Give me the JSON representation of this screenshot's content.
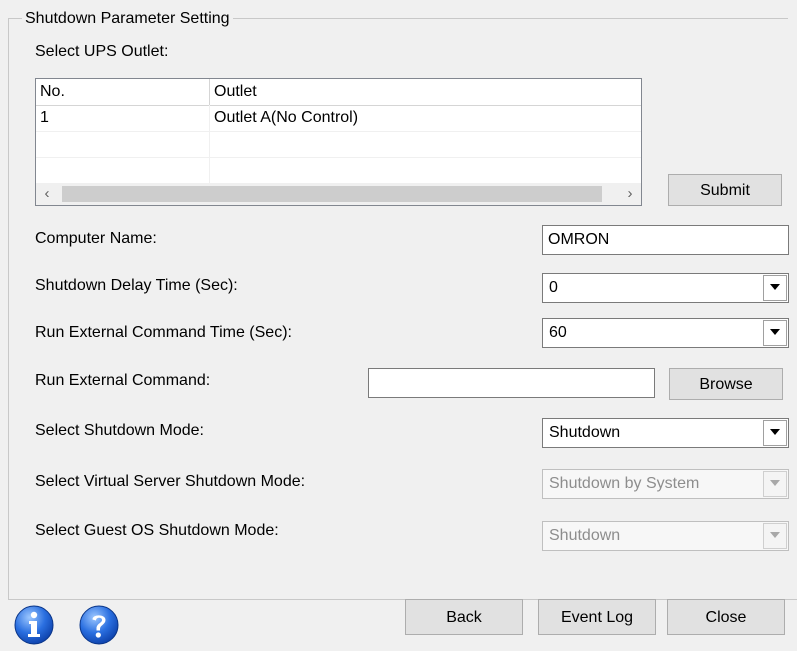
{
  "group": {
    "title": "Shutdown Parameter Setting",
    "outlet_label": "Select UPS Outlet:"
  },
  "outlet_table": {
    "columns": [
      "No.",
      "Outlet"
    ],
    "rows": [
      {
        "no": "1",
        "outlet": "Outlet A(No Control)"
      }
    ]
  },
  "buttons": {
    "submit": "Submit",
    "browse": "Browse",
    "back": "Back",
    "event_log": "Event Log",
    "close": "Close"
  },
  "fields": {
    "computer_name": {
      "label": "Computer Name:",
      "value": "OMRON"
    },
    "shutdown_delay": {
      "label": "Shutdown Delay Time (Sec):",
      "value": "0"
    },
    "run_cmd_time": {
      "label": "Run External Command Time (Sec):",
      "value": "60"
    },
    "run_cmd": {
      "label": "Run External Command:",
      "value": ""
    },
    "shutdown_mode": {
      "label": "Select Shutdown Mode:",
      "value": "Shutdown"
    },
    "vs_shutdown_mode": {
      "label": "Select Virtual Server Shutdown Mode:",
      "value": "Shutdown by System"
    },
    "guest_os_shutdown_mode": {
      "label": "Select Guest OS Shutdown Mode:",
      "value": "Shutdown"
    }
  },
  "icons": {
    "info": "info-icon",
    "help": "help-icon",
    "brand_blue": "#1c5fd1"
  }
}
